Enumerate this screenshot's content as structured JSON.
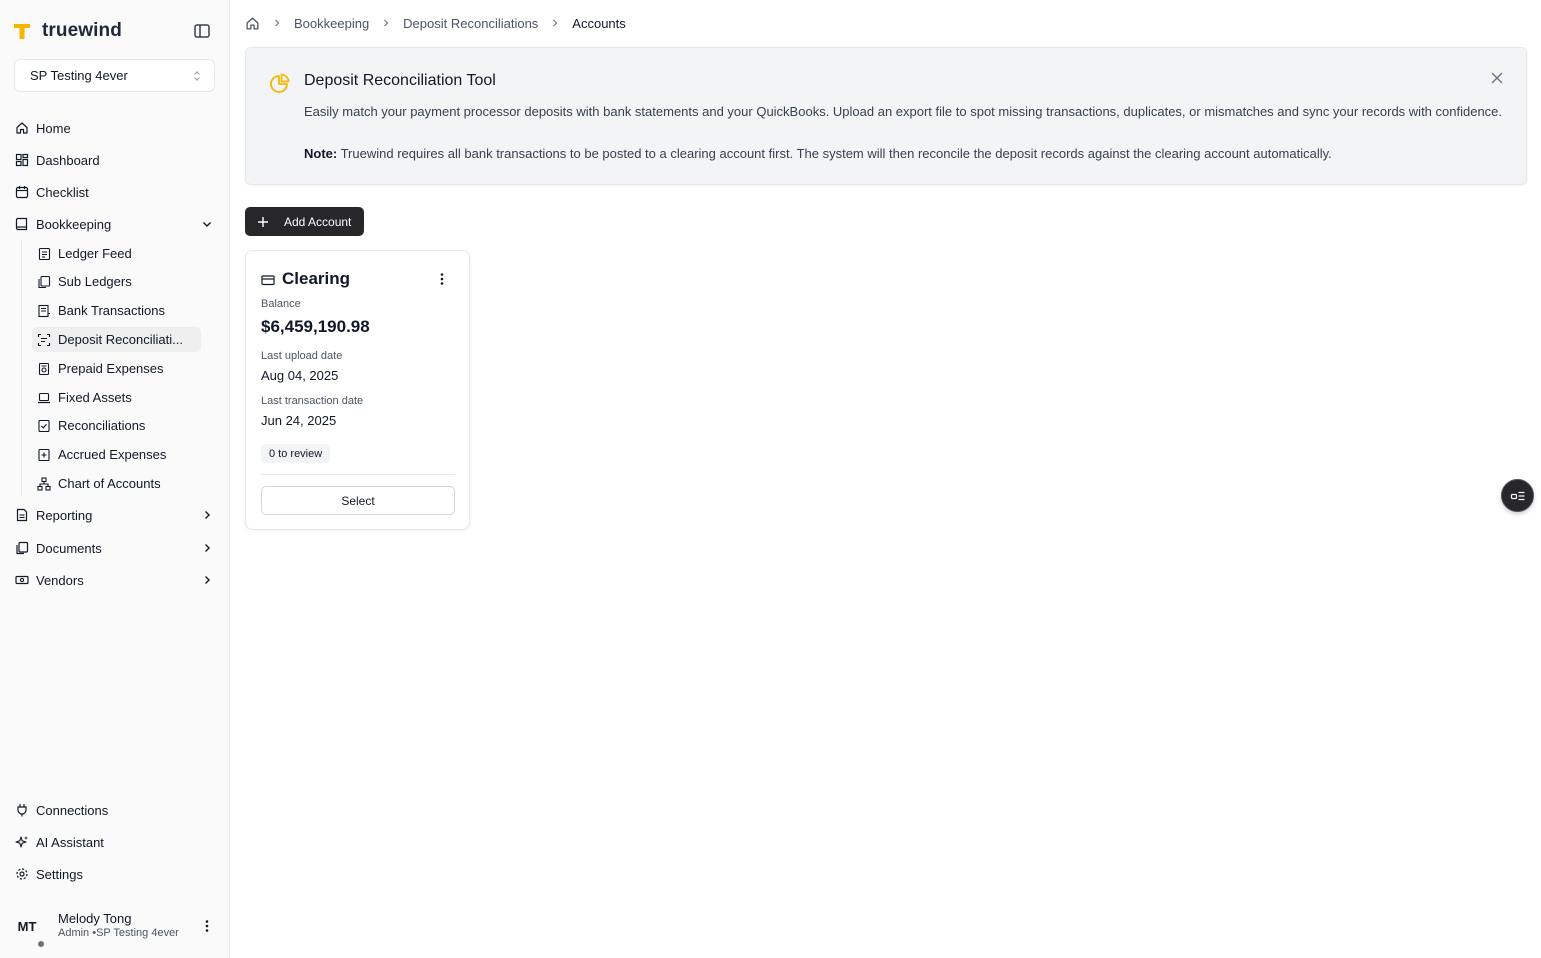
{
  "brand": {
    "name": "truewind",
    "accent": "#f5b700"
  },
  "workspace": {
    "name": "SP Testing 4ever"
  },
  "nav": {
    "home": "Home",
    "dashboard": "Dashboard",
    "checklist": "Checklist",
    "bookkeeping": "Bookkeeping",
    "reporting": "Reporting",
    "documents": "Documents",
    "vendors": "Vendors",
    "connections": "Connections",
    "ai_assistant": "AI Assistant",
    "settings": "Settings"
  },
  "bookkeeping_items": [
    {
      "label": "Ledger Feed",
      "icon": "ledger-icon"
    },
    {
      "label": "Sub Ledgers",
      "icon": "files-icon"
    },
    {
      "label": "Bank Transactions",
      "icon": "bank-icon"
    },
    {
      "label": "Deposit Reconciliati...",
      "icon": "scan-icon",
      "active": true
    },
    {
      "label": "Prepaid Expenses",
      "icon": "prepaid-icon"
    },
    {
      "label": "Fixed Assets",
      "icon": "laptop-icon"
    },
    {
      "label": "Reconciliations",
      "icon": "check-square-icon"
    },
    {
      "label": "Accrued Expenses",
      "icon": "plus-square-icon"
    },
    {
      "label": "Chart of Accounts",
      "icon": "hierarchy-icon"
    }
  ],
  "user": {
    "initials": "MT",
    "name": "Melody Tong",
    "role": "Admin •SP Testing 4ever"
  },
  "breadcrumb": {
    "b1": "Bookkeeping",
    "b2": "Deposit Reconciliations",
    "current": "Accounts"
  },
  "banner": {
    "title": "Deposit Reconciliation Tool",
    "text": "Easily match your payment processor deposits with bank statements and your QuickBooks. Upload an export file to spot missing transactions, duplicates, or mismatches and sync your records with confidence.",
    "note_label": "Note:",
    "note_text": " Truewind requires all bank transactions to be posted to a clearing account first. The system will then reconcile the deposit records against the clearing account automatically."
  },
  "actions": {
    "add_account": "Add Account"
  },
  "account_card": {
    "title": "Clearing",
    "balance_label": "Balance",
    "balance": "$6,459,190.98",
    "upload_label": "Last upload date",
    "upload_date": "Aug 04, 2025",
    "txn_label": "Last transaction date",
    "txn_date": "Jun 24, 2025",
    "review_badge": "0 to review",
    "select_label": "Select"
  }
}
